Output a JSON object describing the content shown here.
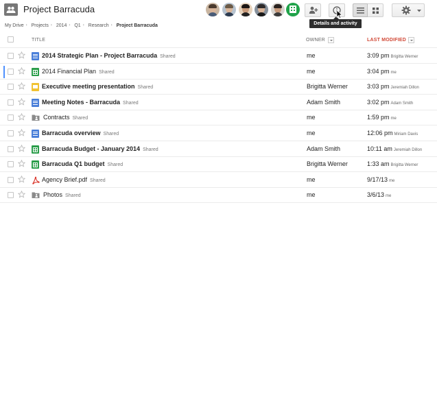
{
  "header": {
    "title": "Project Barracuda",
    "tooltip": "Details and activity"
  },
  "breadcrumb": {
    "items": [
      "My Drive",
      "Projects",
      "2014",
      "Q1",
      "Research"
    ],
    "current": "Project Barracuda"
  },
  "columns": {
    "title": "TITLE",
    "owner": "OWNER",
    "modified": "LAST MODIFIED"
  },
  "files": [
    {
      "name": "2014 Strategic Plan - Project Barracuda",
      "type": "doc",
      "bold": true,
      "shared": "Shared",
      "owner": "me",
      "time": "3:09 pm",
      "by": "Brigitta Werner"
    },
    {
      "name": "2014 Financial Plan",
      "type": "sheet",
      "bold": false,
      "shared": "Shared",
      "owner": "me",
      "time": "3:04 pm",
      "by": "me"
    },
    {
      "name": "Executive meeting presentation",
      "type": "slides",
      "bold": true,
      "shared": "Shared",
      "owner": "Brigitta Werner",
      "time": "3:03 pm",
      "by": "Jeremiah Dillon"
    },
    {
      "name": "Meeting Notes - Barracuda",
      "type": "doc",
      "bold": true,
      "shared": "Shared",
      "owner": "Adam Smith",
      "time": "3:02 pm",
      "by": "Adam Smith"
    },
    {
      "name": "Contracts",
      "type": "folder",
      "bold": false,
      "shared": "Shared",
      "owner": "me",
      "time": "1:59 pm",
      "by": "me"
    },
    {
      "name": "Barracuda overview",
      "type": "doc",
      "bold": true,
      "shared": "Shared",
      "owner": "me",
      "time": "12:06 pm",
      "by": "Miriam Davis"
    },
    {
      "name": "Barracuda Budget - January 2014",
      "type": "sheet",
      "bold": true,
      "shared": "Shared",
      "owner": "Adam Smith",
      "time": "10:11 am",
      "by": "Jeremiah Dillon"
    },
    {
      "name": "Barracuda Q1 budget",
      "type": "sheet",
      "bold": true,
      "shared": "Shared",
      "owner": "Brigitta Werner",
      "time": "1:33 am",
      "by": "Brigitta Werner"
    },
    {
      "name": "Agency Brief.pdf",
      "type": "pdf",
      "bold": false,
      "shared": "Shared",
      "owner": "me",
      "time": "9/17/13",
      "by": "me"
    },
    {
      "name": "Photos",
      "type": "folder",
      "bold": false,
      "shared": "Shared",
      "owner": "me",
      "time": "3/6/13",
      "by": "me"
    }
  ],
  "colors": {
    "accent": "#d14836",
    "doc": "#4a7fd9",
    "sheet": "#2a9d4a",
    "slides": "#f1c232",
    "pdf": "#d93025",
    "group": "#20a34a"
  },
  "icons": {
    "folder": "shared-folder-icon",
    "add_person": "add-person-icon",
    "info": "info-icon",
    "list": "list-view-icon",
    "grid": "grid-view-icon",
    "settings": "gear-icon"
  }
}
